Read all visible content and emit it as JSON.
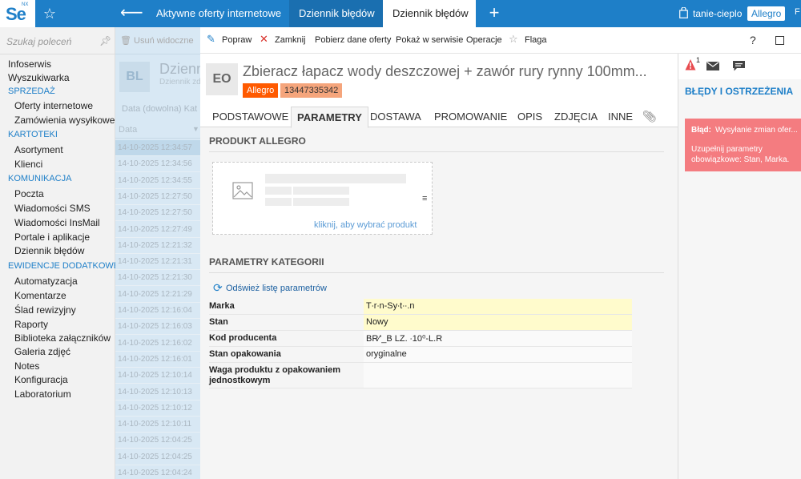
{
  "app": {
    "logo": "Se",
    "logo_superscript": "NX",
    "tabs": [
      {
        "label": "Aktywne oferty internetowe"
      },
      {
        "label": "Dziennik błędów"
      },
      {
        "label": "Dziennik błędów"
      }
    ],
    "shop_name": "tanie-cieplo",
    "platform_badge": "Allegro",
    "more_text": "F"
  },
  "sidebar": {
    "search_placeholder": "Szukaj poleceń",
    "items": [
      {
        "kind": "item",
        "label": "Infoserwis"
      },
      {
        "kind": "item",
        "label": "Wyszukiwarka"
      },
      {
        "kind": "section",
        "label": "SPRZEDAŻ"
      },
      {
        "kind": "sub",
        "label": "Oferty internetowe"
      },
      {
        "kind": "sub",
        "label": "Zamówienia wysyłkowe"
      },
      {
        "kind": "section",
        "label": "KARTOTEKI"
      },
      {
        "kind": "sub",
        "label": "Asortyment"
      },
      {
        "kind": "sub",
        "label": "Klienci"
      },
      {
        "kind": "section",
        "label": "KOMUNIKACJA"
      },
      {
        "kind": "sub",
        "label": "Poczta"
      },
      {
        "kind": "sub",
        "label": "Wiadomości SMS"
      },
      {
        "kind": "sub",
        "label": "Wiadomości InsMail"
      },
      {
        "kind": "sub",
        "label": "Portale i aplikacje"
      },
      {
        "kind": "sub",
        "label": "Dziennik błędów"
      },
      {
        "kind": "section",
        "label": "EWIDENCJE DODATKOWE"
      },
      {
        "kind": "sub",
        "label": "Automatyzacja"
      },
      {
        "kind": "sub",
        "label": "Komentarze"
      },
      {
        "kind": "sub",
        "label": "Ślad rewizyjny"
      },
      {
        "kind": "sub",
        "label": "Raporty"
      },
      {
        "kind": "sub",
        "label": "Biblioteka załączników"
      },
      {
        "kind": "sub",
        "label": "Galeria zdjęć"
      },
      {
        "kind": "sub",
        "label": "Notes"
      },
      {
        "kind": "sub",
        "label": "Konfiguracja"
      },
      {
        "kind": "sub",
        "label": "Laboratorium"
      }
    ]
  },
  "list": {
    "toolbar_button": "Usuń widoczne",
    "avatar": "BL",
    "title": "Dziennik błędów",
    "subtitle": "Dziennik zdarzeń",
    "filter_label": "Data (dowolna)",
    "filter_extra": "Kat",
    "column_header": "Data",
    "rows": [
      "14-10-2025 12:34:57",
      "14-10-2025 12:34:56",
      "14-10-2025 12:34:55",
      "14-10-2025 12:27:50",
      "14-10-2025 12:27:50",
      "14-10-2025 12:27:49",
      "14-10-2025 12:21:32",
      "14-10-2025 12:21:31",
      "14-10-2025 12:21:30",
      "14-10-2025 12:21:29",
      "14-10-2025 12:16:04",
      "14-10-2025 12:16:03",
      "14-10-2025 12:16:02",
      "14-10-2025 12:16:01",
      "14-10-2025 12:10:14",
      "14-10-2025 12:10:13",
      "14-10-2025 12:10:12",
      "14-10-2025 12:10:11",
      "14-10-2025 12:04:25",
      "14-10-2025 12:04:25",
      "14-10-2025 12:04:24"
    ]
  },
  "toolbar": {
    "edit": "Popraw",
    "close": "Zamknij",
    "fetch": "Pobierz dane oferty",
    "show": "Pokaż w serwisie",
    "operations": "Operacje",
    "flag": "Flaga",
    "help": "?"
  },
  "detail": {
    "avatar": "EO",
    "title": "Zbieracz łapacz wody deszczowej + zawór rury rynny 100mm...",
    "badge_platform": "Allegro",
    "badge_id": "13447335342",
    "tabs": [
      "PODSTAWOWE",
      "PARAMETRY",
      "DOSTAWA",
      "PROMOWANIE",
      "OPIS",
      "ZDJĘCIA",
      "INNE"
    ],
    "section_product": "PRODUKT ALLEGRO",
    "pick_link": "kliknij, aby wybrać produkt",
    "section_params": "PARAMETRY KATEGORII",
    "refresh_link": "Odśwież listę parametrów",
    "params": [
      {
        "label": "Marka",
        "value": "T∙r∙n-Sy∙t∙∙.n",
        "required": true
      },
      {
        "label": "Stan",
        "value": "Nowy",
        "required": true
      },
      {
        "label": "Kod producenta",
        "value": "BR∕'_B LZ. ∙10⁰-L.R",
        "required": false
      },
      {
        "label": "Stan opakowania",
        "value": "oryginalne",
        "required": false
      },
      {
        "label": "Waga produktu z opakowaniem jednostkowym",
        "value": "",
        "required": false
      }
    ]
  },
  "right_panel": {
    "count": "1",
    "title": "BŁĘDY I OSTRZEŻENIA",
    "error": {
      "label": "Błąd:",
      "summary": "Wysyłanie zmian ofer...",
      "detail": "Uzupełnij parametry obowiązkowe: Stan, Marka."
    }
  },
  "colors": {
    "brand": "#1e7fc8",
    "allegro": "#ff5a00",
    "error_card": "#f47c80",
    "required_field": "#fffbcc"
  }
}
